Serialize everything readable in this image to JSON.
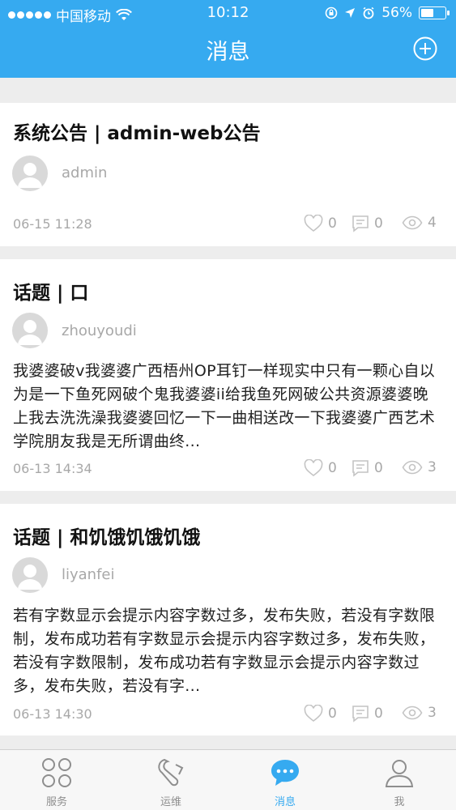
{
  "status_bar": {
    "carrier": "中国移动",
    "time": "10:12",
    "battery": "56%",
    "battery_level": 0.56
  },
  "header": {
    "title": "消息"
  },
  "posts": [
    {
      "title": "系统公告 | admin-web公告",
      "author": "admin",
      "body": "",
      "date": "06-15 11:28",
      "likes": "0",
      "comments": "0",
      "views": "4"
    },
    {
      "title": "话题 | 口",
      "author": "zhouyoudi",
      "body": "我婆婆破v我婆婆广西梧州OP耳钉一样现实中只有一颗心自以为是一下鱼死网破个鬼我婆婆ii给我鱼死网破公共资源婆婆晚上我去洗洗澡我婆婆回忆一下一曲相送改一下我婆婆广西艺术学院朋友我是无所谓曲终...",
      "date": "06-13 14:34",
      "likes": "0",
      "comments": "0",
      "views": "3"
    },
    {
      "title": "话题 | 和饥饿饥饿饥饿",
      "author": "liyanfei",
      "body": "若有字数显示会提示内容字数过多，发布失败，若没有字数限制，发布成功若有字数显示会提示内容字数过多，发布失败，若没有字数限制，发布成功若有字数显示会提示内容字数过多，发布失败，若没有字...",
      "date": "06-13 14:30",
      "likes": "0",
      "comments": "0",
      "views": "3"
    }
  ],
  "tabbar": {
    "tabs": [
      {
        "label": "服务"
      },
      {
        "label": "运维"
      },
      {
        "label": "消息"
      },
      {
        "label": "我"
      }
    ],
    "active_color": "#36aaf0"
  }
}
